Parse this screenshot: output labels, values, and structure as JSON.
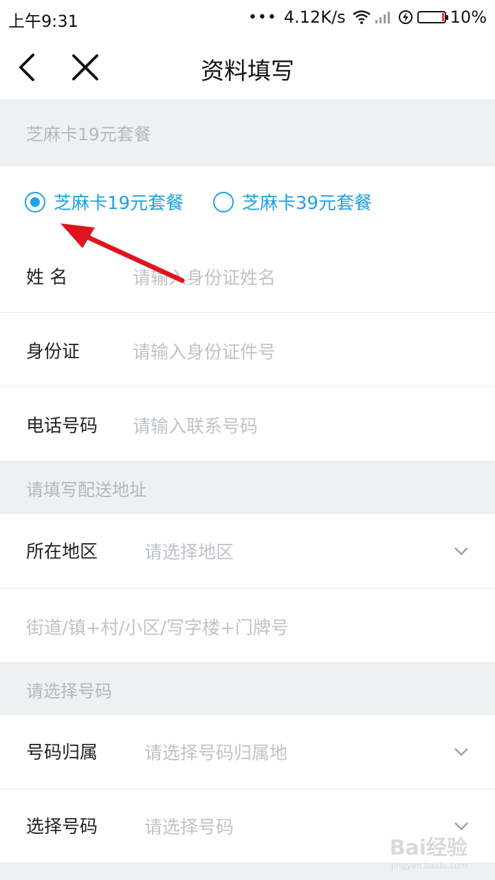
{
  "status_bar": {
    "time": "上午9:31",
    "dots": "•••",
    "speed": "4.12K/s",
    "battery": "10%",
    "icons": [
      "wifi-icon",
      "signal-icon",
      "charging-icon",
      "battery-icon"
    ]
  },
  "nav": {
    "title": "资料填写",
    "icons": [
      "back-arrow-icon",
      "close-icon"
    ]
  },
  "sections": {
    "package": "芝麻卡19元套餐",
    "address": "请填写配送地址",
    "number": "请选择号码"
  },
  "package_options": [
    {
      "label": "芝麻卡19元套餐",
      "selected": true
    },
    {
      "label": "芝麻卡39元套餐",
      "selected": false
    }
  ],
  "fields": {
    "name": {
      "label": "姓  名",
      "placeholder": "请输入身份证姓名"
    },
    "id": {
      "label": "身份证",
      "placeholder": "请输入身份证件号"
    },
    "phone": {
      "label": "电话号码",
      "placeholder": "请输入联系号码"
    },
    "region": {
      "label": "所在地区",
      "placeholder": "请选择地区"
    },
    "street": {
      "placeholder": "街道/镇+村/小区/写字楼+门牌号"
    },
    "attribution": {
      "label": "号码归属",
      "placeholder": "请选择号码归属地"
    },
    "select_number": {
      "label": "选择号码",
      "placeholder": "请选择号码"
    }
  },
  "watermark": {
    "text": "Bai经验",
    "sub": "jingyan.baidu.com"
  },
  "colors": {
    "accent": "#1ea1e0",
    "annotation_arrow": "#e0141e",
    "section_bg": "#eef1f3"
  }
}
